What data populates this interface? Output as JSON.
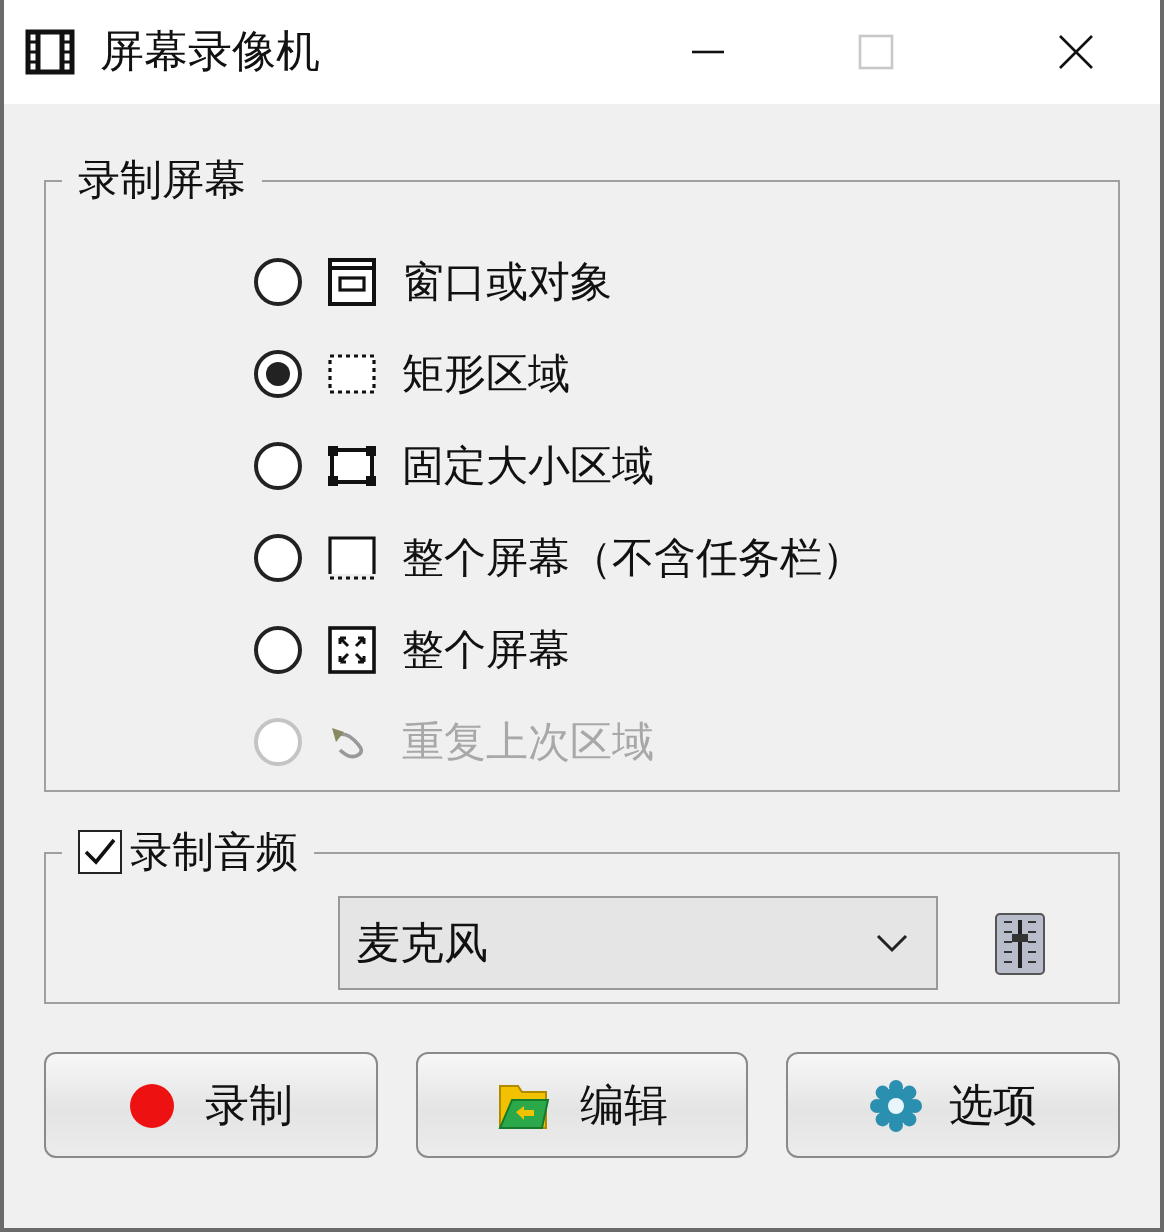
{
  "window": {
    "title": "屏幕录像机",
    "controls": [
      {
        "kind": "minimize",
        "disabled": false
      },
      {
        "kind": "maximize",
        "disabled": true
      },
      {
        "kind": "close",
        "disabled": false
      }
    ]
  },
  "screen_group": {
    "title": "录制屏幕",
    "options": [
      {
        "kind": "window",
        "label": "窗口或对象",
        "selected": false,
        "disabled": false
      },
      {
        "kind": "rectangle",
        "label": "矩形区域",
        "selected": true,
        "disabled": false
      },
      {
        "kind": "fixed",
        "label": "固定大小区域",
        "selected": false,
        "disabled": false
      },
      {
        "kind": "no-taskbar",
        "label": "整个屏幕（不含任务栏）",
        "selected": false,
        "disabled": false
      },
      {
        "kind": "fullscreen",
        "label": "整个屏幕",
        "selected": false,
        "disabled": false
      },
      {
        "kind": "repeat",
        "label": "重复上次区域",
        "selected": false,
        "disabled": true
      }
    ]
  },
  "audio_group": {
    "title": "录制音频",
    "checked": true,
    "device": "麦克风"
  },
  "buttons": [
    {
      "kind": "record",
      "label": "录制"
    },
    {
      "kind": "edit",
      "label": "编辑"
    },
    {
      "kind": "options",
      "label": "选项"
    }
  ]
}
